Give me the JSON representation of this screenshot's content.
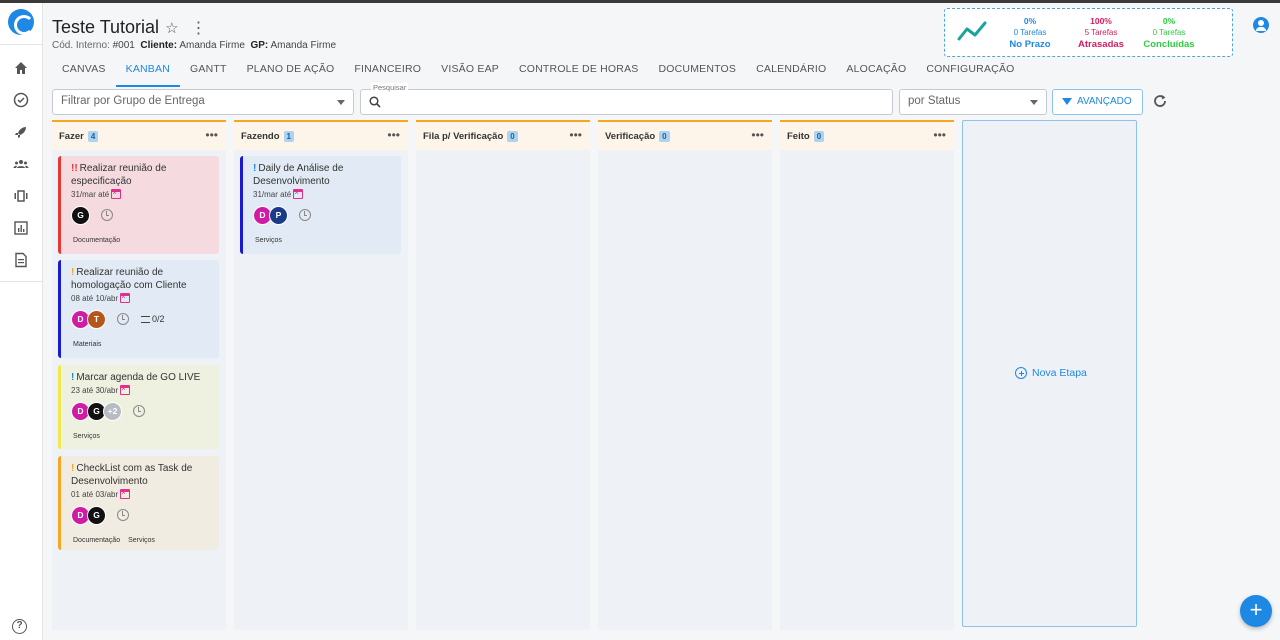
{
  "header": {
    "title": "Teste Tutorial",
    "star": "☆",
    "menu": "⋮",
    "codigo_label": "Cód. Interno:",
    "codigo_value": "#001",
    "cliente_label": "Cliente:",
    "cliente_value": "Amanda Firme",
    "gp_label": "GP:",
    "gp_value": "Amanda Firme"
  },
  "tabs": [
    {
      "label": "CANVAS"
    },
    {
      "label": "KANBAN"
    },
    {
      "label": "GANTT"
    },
    {
      "label": "PLANO DE AÇÃO"
    },
    {
      "label": "FINANCEIRO"
    },
    {
      "label": "VISÃO EAP"
    },
    {
      "label": "CONTROLE DE HORAS"
    },
    {
      "label": "DOCUMENTOS"
    },
    {
      "label": "CALENDÁRIO"
    },
    {
      "label": "ALOCAÇÃO"
    },
    {
      "label": "CONFIGURAÇÃO"
    }
  ],
  "active_tab": "KANBAN",
  "stats": {
    "no_prazo": {
      "pct": "0%",
      "tarefas": "0 Tarefas",
      "label": "No Prazo",
      "color": "#1e88e5"
    },
    "atrasadas": {
      "pct": "100%",
      "tarefas": "5 Tarefas",
      "label": "Atrasadas",
      "color": "#d81b60"
    },
    "concluidas": {
      "pct": "0%",
      "tarefas": "0 Tarefas",
      "label": "Concluídas",
      "color": "#2ecc40"
    }
  },
  "filters": {
    "grupo_placeholder": "Filtrar por Grupo de Entrega",
    "pesquisar_legend": "Pesquisar",
    "status_placeholder": "por Status",
    "avancado_label": "AVANÇADO"
  },
  "columns": [
    {
      "name": "Fazer",
      "count": "4",
      "more": "•••",
      "cards": [
        {
          "prio": "!!",
          "prio_color": "#e53935",
          "title": "Realizar reunião de especificação",
          "date": "31/mar até",
          "avatars": [
            {
              "letter": "G",
              "color": "#111111"
            }
          ],
          "checklist": "",
          "tags": [
            "Documentação"
          ],
          "bar_color": "#e53935",
          "bg": "#f5dbe0"
        },
        {
          "prio": "!",
          "prio_color": "#f5a623",
          "title": "Realizar reunião de homologação com Cliente",
          "date": "08 até 10/abr",
          "avatars": [
            {
              "letter": "D",
              "color": "#d01ca4"
            },
            {
              "letter": "T",
              "color": "#b5571b"
            }
          ],
          "checklist": "0/2",
          "tags": [
            "Materiais"
          ],
          "bar_color": "#1a1ad0",
          "bg": "#e2ebf5"
        },
        {
          "prio": "!",
          "prio_color": "#1e88e5",
          "title": "Marcar agenda de GO LIVE",
          "date": "23 até 30/abr",
          "avatars": [
            {
              "letter": "D",
              "color": "#d01ca4"
            },
            {
              "letter": "G",
              "color": "#111111"
            },
            {
              "letter": "+2",
              "color": "#b8bcc2"
            }
          ],
          "checklist": "",
          "tags": [
            "Serviços"
          ],
          "bar_color": "#f0e94a",
          "bg": "#eef0e0"
        },
        {
          "prio": "!",
          "prio_color": "#f5a623",
          "title": "CheckList com as Task de Desenvolvimento",
          "date": "01 até 03/abr",
          "avatars": [
            {
              "letter": "D",
              "color": "#d01ca4"
            },
            {
              "letter": "G",
              "color": "#111111"
            }
          ],
          "checklist": "",
          "tags": [
            "Documentação",
            "Serviços"
          ],
          "bar_color": "#f5a623",
          "bg": "#f1ece1"
        }
      ]
    },
    {
      "name": "Fazendo",
      "count": "1",
      "more": "•••",
      "cards": [
        {
          "prio": "!",
          "prio_color": "#1e88e5",
          "title": "Daily de Análise de Desenvolvimento",
          "date": "31/mar até",
          "avatars": [
            {
              "letter": "D",
              "color": "#d01ca4"
            },
            {
              "letter": "P",
              "color": "#1a3a8a"
            }
          ],
          "checklist": "",
          "tags": [
            "Serviços"
          ],
          "bar_color": "#1a1ad0",
          "bg": "#e2ebf5"
        }
      ]
    },
    {
      "name": "Fila p/ Verificação",
      "count": "0",
      "more": "•••",
      "cards": []
    },
    {
      "name": "Verificação",
      "count": "0",
      "more": "•••",
      "cards": []
    },
    {
      "name": "Feito",
      "count": "0",
      "more": "•••",
      "cards": []
    }
  ],
  "nova_etapa": "Nova Etapa",
  "fab_label": "+",
  "help_label": "?"
}
